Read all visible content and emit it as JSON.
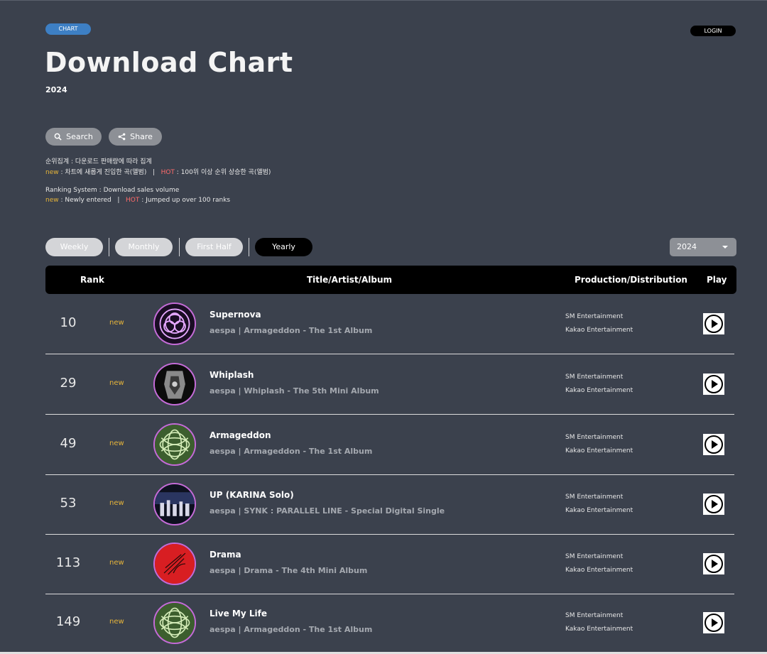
{
  "header": {
    "badge": "CHART",
    "login": "LOGIN",
    "title": "Download Chart",
    "year": "2024"
  },
  "actions": {
    "search": "Search",
    "share": "Share"
  },
  "description": {
    "ko_line1": "순위집계 : 다운로드 판매량에 따라 집계",
    "ko_new": "new",
    "ko_new_text": " : 차트에 새롭게 진입한 곡(앨범)",
    "ko_sep": "|",
    "ko_hot": "HOT",
    "ko_hot_text": " : 100위 이상 순위 상승한 곡(앨범)",
    "en_line1": "Ranking System : Download sales volume",
    "en_new": "new",
    "en_new_text": " : Newly entered",
    "en_sep": "|",
    "en_hot": "HOT",
    "en_hot_text": " : Jumped up over 100 ranks"
  },
  "tabs": [
    "Weekly",
    "Monthly",
    "First Half",
    "Yearly"
  ],
  "active_tab": "Yearly",
  "year_select": {
    "value": "2024"
  },
  "table": {
    "headers": {
      "rank": "Rank",
      "title": "Title/Artist/Album",
      "production": "Production/Distribution",
      "play": "Play"
    },
    "rows": [
      {
        "rank": "10",
        "tag": "new",
        "title": "Supernova",
        "sub": "aespa | Armageddon - The 1st Album",
        "production": "SM Entertainment",
        "distribution": "Kakao Entertainment",
        "cover": "supernova"
      },
      {
        "rank": "29",
        "tag": "new",
        "title": "Whiplash",
        "sub": "aespa | Whiplash - The 5th Mini Album",
        "production": "SM Entertainment",
        "distribution": "Kakao Entertainment",
        "cover": "whiplash"
      },
      {
        "rank": "49",
        "tag": "new",
        "title": "Armageddon",
        "sub": "aespa | Armageddon - The 1st Album",
        "production": "SM Entertainment",
        "distribution": "Kakao Entertainment",
        "cover": "armageddon"
      },
      {
        "rank": "53",
        "tag": "new",
        "title": "UP (KARINA Solo)",
        "sub": "aespa | SYNK : PARALLEL LINE - Special Digital Single",
        "production": "SM Entertainment",
        "distribution": "Kakao Entertainment",
        "cover": "synk"
      },
      {
        "rank": "113",
        "tag": "new",
        "title": "Drama",
        "sub": "aespa | Drama - The 4th Mini Album",
        "production": "SM Entertainment",
        "distribution": "Kakao Entertainment",
        "cover": "drama"
      },
      {
        "rank": "149",
        "tag": "new",
        "title": "Live My Life",
        "sub": "aespa | Armageddon - The 1st Album",
        "production": "SM Entertainment",
        "distribution": "Kakao Entertainment",
        "cover": "armageddon"
      }
    ]
  },
  "colors": {
    "background": "#3b414d",
    "new": "#e6b43a",
    "hot": "#ff6b6b",
    "badge": "#3d7fc4"
  }
}
